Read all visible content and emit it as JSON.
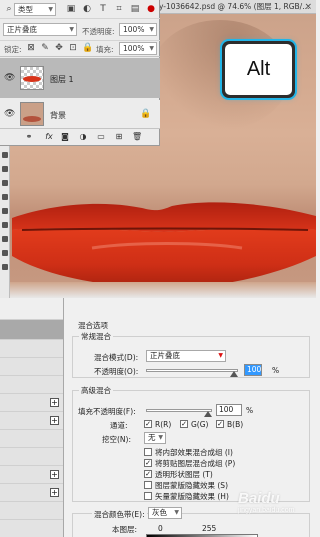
{
  "document": {
    "title": "ty-1036642.psd @ 74.6% (图层 1, RGB/..."
  },
  "overlay_key": {
    "label": "Alt"
  },
  "layers_panel": {
    "filter_select": "类型",
    "blend_mode": "正片叠底",
    "opacity_label": "不透明度:",
    "opacity_value": "100%",
    "lock_label": "锁定:",
    "fill_label": "填充:",
    "fill_value": "100%",
    "layers": [
      {
        "name": "图层 1"
      },
      {
        "name": "背景"
      }
    ]
  },
  "layer_style": {
    "section_title": "混合选项",
    "general_blending": {
      "legend": "常规混合",
      "blend_mode_label": "混合模式(D):",
      "blend_mode_value": "正片叠底",
      "opacity_label": "不透明度(O):",
      "opacity_value": "100",
      "percent": "%"
    },
    "advanced_blending": {
      "legend": "高级混合",
      "fill_opacity_label": "填充不透明度(F):",
      "fill_opacity_value": "100",
      "percent": "%",
      "channels_label": "通道:",
      "channels": [
        {
          "label": "R(R)",
          "checked": true
        },
        {
          "label": "G(G)",
          "checked": true
        },
        {
          "label": "B(B)",
          "checked": true
        }
      ],
      "knockout_label": "挖空(N):",
      "knockout_value": "无",
      "options": [
        {
          "label": "将内部效果混合成组 (I)",
          "checked": false
        },
        {
          "label": "将剪贴图层混合成组 (P)",
          "checked": true
        },
        {
          "label": "透明形状图层 (T)",
          "checked": true
        },
        {
          "label": "图层蒙版隐藏效果 (S)",
          "checked": false
        },
        {
          "label": "矢量蒙版隐藏效果 (H)",
          "checked": false
        }
      ]
    },
    "blend_if": {
      "legend": "混合颜色带(E):",
      "value": "灰色",
      "this_layer_label": "本图层:",
      "low": "0",
      "high": "255"
    }
  },
  "watermark": {
    "brand": "Baidu",
    "sub": "jingyan.baidu.com"
  }
}
